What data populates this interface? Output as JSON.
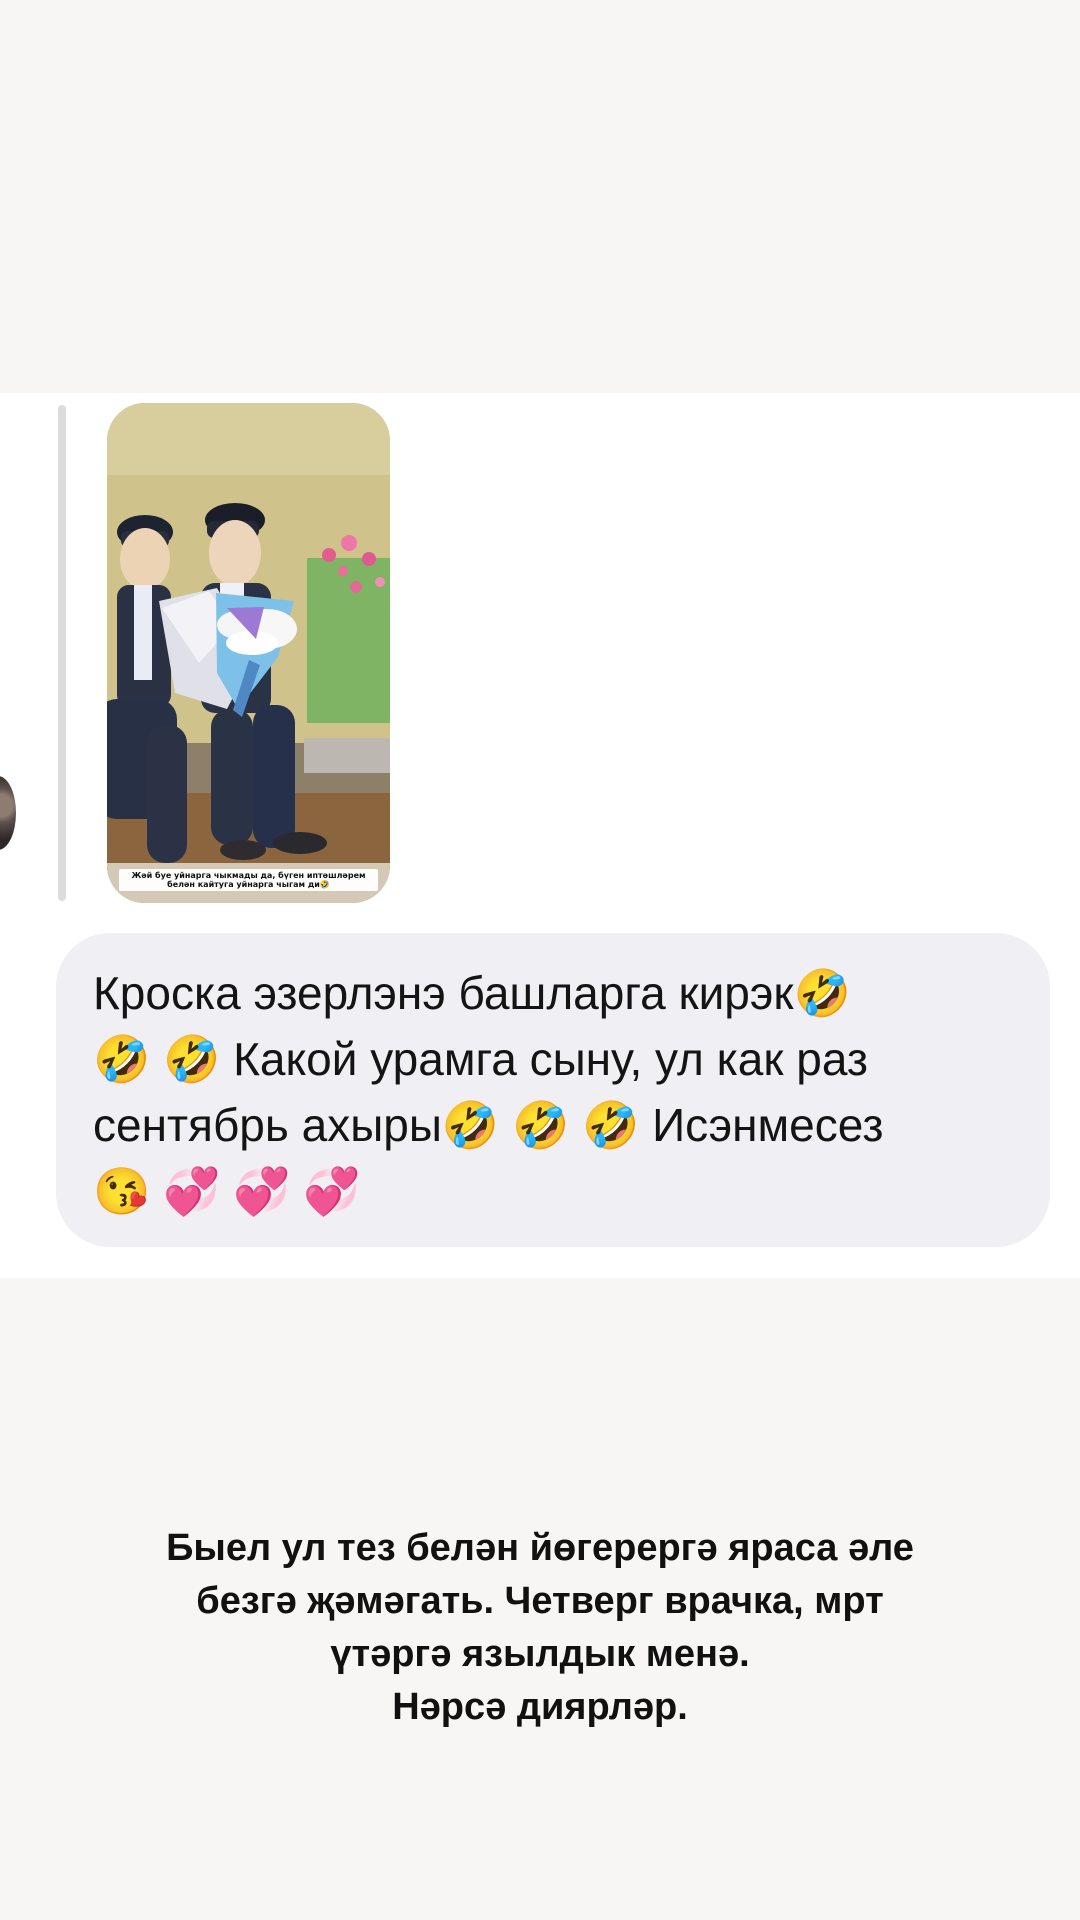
{
  "story": {
    "media_caption": "Жәй буе уйнарга чыкмады да, бүген иптәшләрем\nбелән кайтуга уйнарга чыгам ди🤣",
    "message_text": "Кроска эзерлэнэ башларга кирэк🤣\n🤣 🤣 Какой урамга сыну, ул как раз\nсентябрь ахыры🤣 🤣 🤣 Исэнмесез\n😘 💞 💞 💞",
    "bottom_text": "Быел ул тез белән йөгерергә яраса әле\nбезгә җәмәгать. Четверг врачка, мрт\nүтәргә язылдык менә.\nНәрсә диярләр."
  }
}
